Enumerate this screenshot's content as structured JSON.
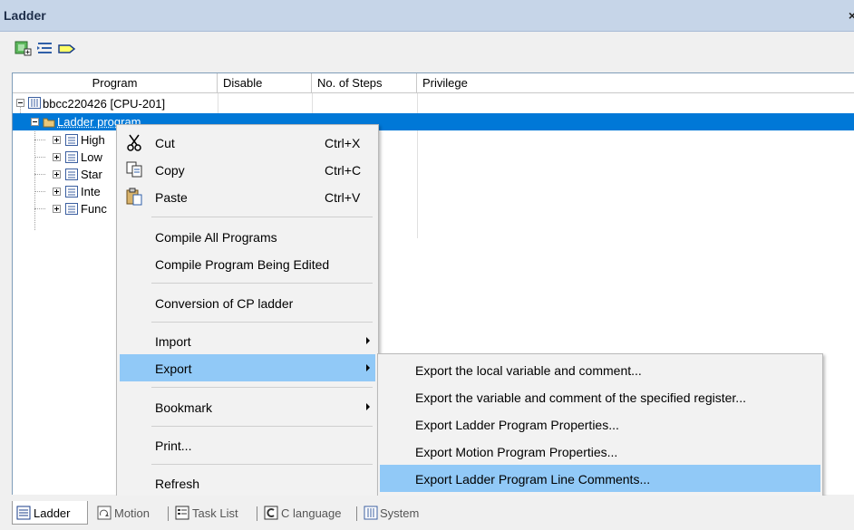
{
  "window": {
    "title": "Ladder",
    "close_glyph": "×"
  },
  "toolbar": {
    "icons": [
      "add-program-icon",
      "list-indent-icon",
      "label-tag-icon"
    ]
  },
  "table": {
    "columns": [
      "Program",
      "Disable",
      "No. of Steps",
      "Privilege"
    ],
    "rows": [
      {
        "label": "bbcc220426 [CPU-201]",
        "icon": "cpu-icon",
        "expander": "minus"
      },
      {
        "label": "Ladder program",
        "icon": "folder-icon",
        "expander": "minus",
        "selected": true
      },
      {
        "label": "High",
        "icon": "program-icon",
        "expander": "plus"
      },
      {
        "label": "Low",
        "icon": "program-icon",
        "expander": "plus"
      },
      {
        "label": "Star",
        "icon": "program-icon",
        "expander": "plus"
      },
      {
        "label": "Inte",
        "icon": "program-icon",
        "expander": "plus"
      },
      {
        "label": "Func",
        "icon": "program-icon",
        "expander": "plus"
      }
    ]
  },
  "context_menu": {
    "items": [
      {
        "label": "Cut",
        "shortcut": "Ctrl+X",
        "icon": "scissors-icon"
      },
      {
        "label": "Copy",
        "shortcut": "Ctrl+C",
        "icon": "copy-icon"
      },
      {
        "label": "Paste",
        "shortcut": "Ctrl+V",
        "icon": "paste-icon"
      },
      {
        "label": "Compile All Programs"
      },
      {
        "label": "Compile Program Being Edited"
      },
      {
        "label": "Conversion of CP ladder"
      },
      {
        "label": "Import",
        "submenu": true
      },
      {
        "label": "Export",
        "submenu": true,
        "active": true
      },
      {
        "label": "Bookmark",
        "submenu": true
      },
      {
        "label": "Print..."
      },
      {
        "label": "Refresh"
      }
    ]
  },
  "export_submenu": {
    "items": [
      {
        "label": "Export the local variable and comment..."
      },
      {
        "label": "Export the variable and comment of the specified register..."
      },
      {
        "label": "Export Ladder Program Properties..."
      },
      {
        "label": "Export Motion Program Properties..."
      },
      {
        "label": "Export Ladder Program Line Comments...",
        "active": true
      }
    ]
  },
  "tabs": [
    {
      "label": "Ladder",
      "icon": "ladder-icon",
      "active": true
    },
    {
      "label": "Motion",
      "icon": "motion-icon"
    },
    {
      "label": "Task List",
      "icon": "task-list-icon"
    },
    {
      "label": "C language",
      "icon": "c-language-icon"
    },
    {
      "label": "System",
      "icon": "system-icon"
    }
  ],
  "colors": {
    "selection": "#0078d7",
    "menu_highlight": "#91c9f7",
    "titlebar": "#c6d5e8"
  }
}
